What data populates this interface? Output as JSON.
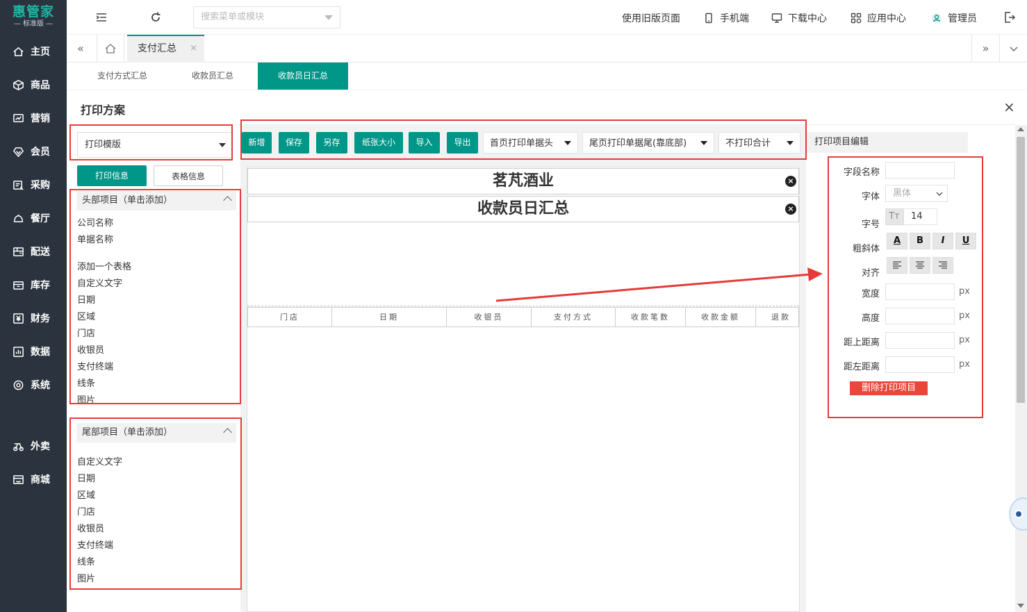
{
  "app": {
    "logo": "惠管家",
    "edition": "— 标准版 —"
  },
  "nav": [
    {
      "label": "主页",
      "icon": "home-icon"
    },
    {
      "label": "商品",
      "icon": "box-icon"
    },
    {
      "label": "营销",
      "icon": "chart-icon"
    },
    {
      "label": "会员",
      "icon": "diamond-icon"
    },
    {
      "label": "采购",
      "icon": "purchase-icon"
    },
    {
      "label": "餐厅",
      "icon": "cloche-icon"
    },
    {
      "label": "配送",
      "icon": "delivery-icon"
    },
    {
      "label": "库存",
      "icon": "inventory-icon"
    },
    {
      "label": "财务",
      "icon": "finance-icon"
    },
    {
      "label": "数据",
      "icon": "data-icon"
    },
    {
      "label": "系统",
      "icon": "settings-icon"
    },
    {
      "label": "外卖",
      "icon": "takeout-icon"
    },
    {
      "label": "商城",
      "icon": "store-icon"
    }
  ],
  "topbar": {
    "search_placeholder": "搜索菜单或模块",
    "links": [
      {
        "label": "使用旧版页面"
      },
      {
        "label": "手机端",
        "icon": "mobile-icon"
      },
      {
        "label": "下载中心",
        "icon": "monitor-icon"
      },
      {
        "label": "应用中心",
        "icon": "apps-icon"
      },
      {
        "label": "管理员",
        "icon": "user-icon"
      }
    ]
  },
  "tabs": {
    "active": "支付汇总",
    "close": "×"
  },
  "subtabs": [
    "支付方式汇总",
    "收款员汇总",
    "收款员日汇总"
  ],
  "dialog": {
    "title": "打印方案",
    "close": "×",
    "template_select": "打印模版",
    "btn_print_info": "打印信息",
    "btn_table_info": "表格信息",
    "header_section": "头部项目（单击添加）",
    "header_items": [
      "公司名称",
      "单据名称",
      "添加一个表格",
      "自定义文字",
      "日期",
      "区域",
      "门店",
      "收银员",
      "支付终端",
      "线条",
      "图片"
    ],
    "footer_section": "尾部项目（单击添加）",
    "footer_items": [
      "自定义文字",
      "日期",
      "区域",
      "门店",
      "收银员",
      "支付终端",
      "线条",
      "图片"
    ],
    "toolbar": [
      "新增",
      "保存",
      "另存",
      "纸张大小",
      "导入",
      "导出"
    ],
    "dropdowns": [
      "首页打印单据头",
      "尾页打印单据尾(靠底部)",
      "不打印合计"
    ],
    "preview_company": "茗芃酒业",
    "preview_title": "收款员日汇总",
    "table_headers": [
      "门店",
      "日期",
      "收银员",
      "支付方式",
      "收款笔数",
      "收款金额",
      "退款笔"
    ],
    "editor": {
      "title": "打印项目编辑",
      "field_name": "字段名称",
      "font": "字体",
      "font_value": "黑体",
      "font_size": "字号",
      "font_size_value": "14",
      "style": "粗斜体",
      "style_buttons": [
        "A",
        "B",
        "I",
        "U"
      ],
      "align": "对齐",
      "width": "宽度",
      "height": "高度",
      "top": "距上距离",
      "left": "距左距离",
      "unit": "px",
      "delete": "删除打印项目"
    }
  },
  "colors": {
    "accent": "#009688",
    "sidebar": "#2b333e",
    "highlight": "#e63a3a"
  }
}
